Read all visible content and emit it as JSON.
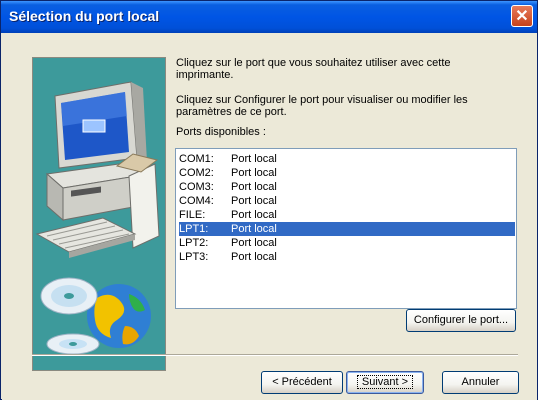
{
  "window": {
    "title": "Sélection du port local",
    "close_label": "✕"
  },
  "content": {
    "instruction_1": "Cliquez sur le port que vous souhaitez utiliser avec cette imprimante.",
    "instruction_2": "Cliquez sur Configurer le port pour visualiser ou modifier les paramètres de ce port.",
    "ports_label": "Ports disponibles :"
  },
  "ports": [
    {
      "name": "COM1:",
      "desc": "Port local",
      "selected": false
    },
    {
      "name": "COM2:",
      "desc": "Port local",
      "selected": false
    },
    {
      "name": "COM3:",
      "desc": "Port local",
      "selected": false
    },
    {
      "name": "COM4:",
      "desc": "Port local",
      "selected": false
    },
    {
      "name": "FILE:",
      "desc": "Port local",
      "selected": false
    },
    {
      "name": "LPT1:",
      "desc": "Port local",
      "selected": true
    },
    {
      "name": "LPT2:",
      "desc": "Port local",
      "selected": false
    },
    {
      "name": "LPT3:",
      "desc": "Port local",
      "selected": false
    }
  ],
  "buttons": {
    "configure": "Configurer le port...",
    "previous": "< Précédent",
    "next": "Suivant >",
    "cancel": "Annuler"
  },
  "colors": {
    "selection": "#316AC5",
    "titlebar": "#0055E5",
    "artwork_bg": "#3D9A9B"
  },
  "icons": {
    "artwork": "computer-printer-and-cd-illustration"
  }
}
